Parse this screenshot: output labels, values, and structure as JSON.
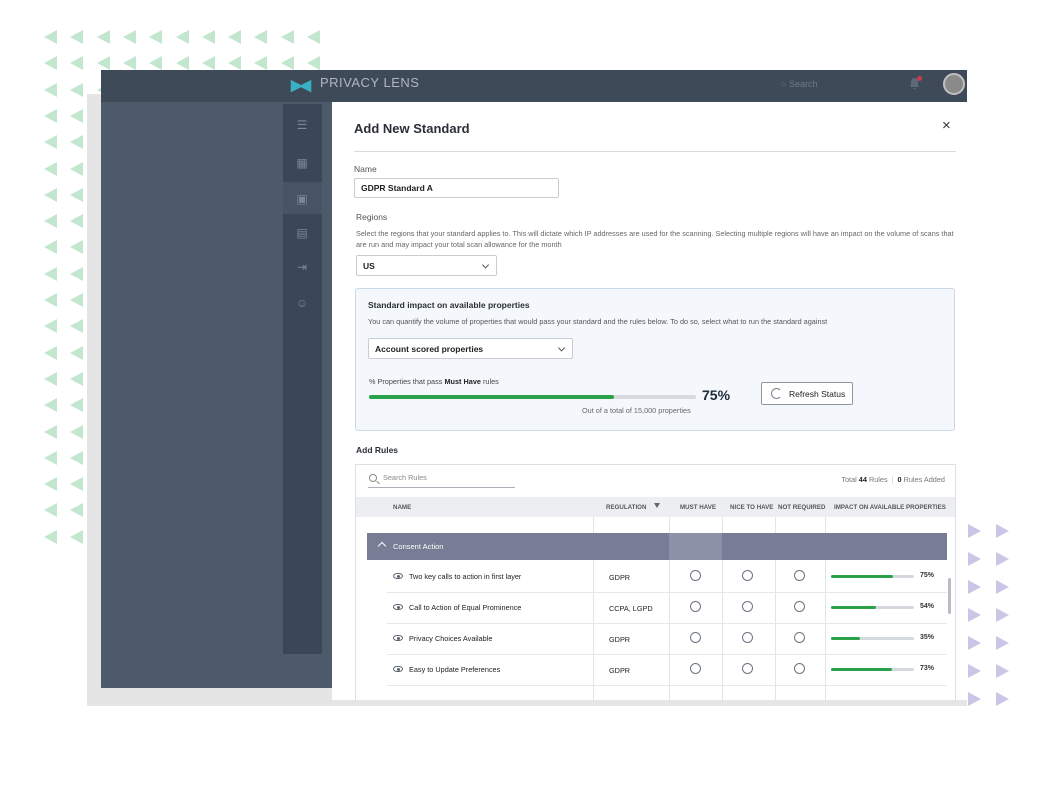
{
  "app": {
    "brand": "PRIVACY LENS",
    "search_placeholder": "Search"
  },
  "modal": {
    "title": "Add New Standard",
    "close_label": "×",
    "name_label": "Name",
    "name_value": "GDPR Standard A",
    "regions_label": "Regions",
    "regions_help": "Select the regions that your standard applies to. This will dictate which IP addresses are used for the scanning. Selecting multiple regions will have an impact on the volume of scans that are run and may impact your total scan allowance for the month",
    "region_value": "US"
  },
  "impact": {
    "title": "Standard impact on available properties",
    "description": "You can quantify the volume of properties that would pass your standard and the rules below. To do so, select what to run the standard against",
    "select_value": "Account scored properties",
    "pass_label_prefix": "% Properties that pass ",
    "pass_label_bold": "Must Have",
    "pass_label_suffix": " rules",
    "pass_percent_value": 75,
    "pass_percent_text": "75%",
    "out_of_text": "Out of a total of 15,000 properties",
    "refresh_label": "Refresh Status"
  },
  "rules": {
    "label": "Add Rules",
    "search_placeholder": "Search Rules",
    "total_prefix": "Total ",
    "total_count": "44",
    "total_suffix": " Rules",
    "added_count": "0",
    "added_suffix": " Rules Added",
    "columns": {
      "name": "NAME",
      "regulation": "REGULATION",
      "must_have": "MUST HAVE",
      "nice_to_have": "NICE TO HAVE",
      "not_required": "NOT REQUIRED",
      "impact": "IMPACT ON AVAILABLE PROPERTIES"
    },
    "group": {
      "name": "Consent Action"
    },
    "rows": [
      {
        "name": "Two key calls to action in first layer",
        "regulation": "GDPR",
        "impact_value": 75,
        "impact_text": "75%"
      },
      {
        "name": "Call to Action of Equal Prominence",
        "regulation": "CCPA, LGPD",
        "impact_value": 54,
        "impact_text": "54%"
      },
      {
        "name": "Privacy Choices Available",
        "regulation": "GDPR",
        "impact_value": 35,
        "impact_text": "35%"
      },
      {
        "name": "Easy to Update Preferences",
        "regulation": "GDPR",
        "impact_value": 73,
        "impact_text": "73%"
      }
    ]
  },
  "colors": {
    "accent_green": "#2aa24a",
    "group_row": "#767d94",
    "decor_green": "#c3e6cf",
    "decor_purple": "#cbc6e6"
  }
}
